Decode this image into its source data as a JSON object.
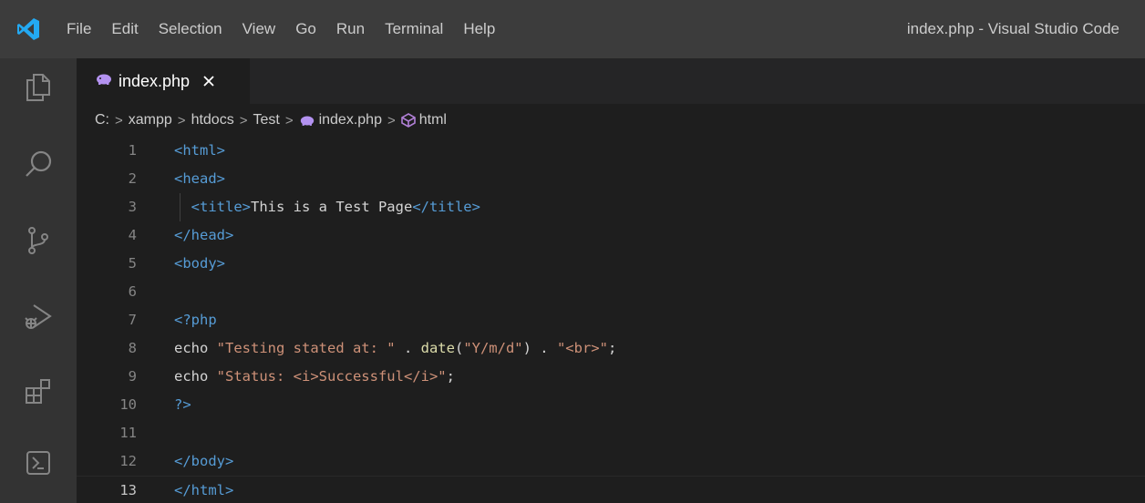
{
  "menu": {
    "items": [
      "File",
      "Edit",
      "Selection",
      "View",
      "Go",
      "Run",
      "Terminal",
      "Help"
    ]
  },
  "window_title": "index.php - Visual Studio Code",
  "tab": {
    "label": "index.php",
    "close": "✕"
  },
  "breadcrumb": {
    "items": [
      "C:",
      "xampp",
      "htdocs",
      "Test",
      "index.php",
      "html"
    ],
    "separator": ">"
  },
  "activity_icons": [
    "explorer-icon",
    "search-icon",
    "source-control-icon",
    "run-debug-icon",
    "extensions-icon",
    "terminal-icon"
  ],
  "editor": {
    "active_line": 13,
    "lines": [
      {
        "n": "1",
        "tokens": [
          [
            "tag",
            "<html>"
          ]
        ]
      },
      {
        "n": "2",
        "tokens": [
          [
            "tag",
            "<head>"
          ]
        ]
      },
      {
        "n": "3",
        "tokens": [
          [
            "tag",
            "  <title>"
          ],
          [
            "text",
            "This is a Test Page"
          ],
          [
            "tag",
            "</title>"
          ]
        ]
      },
      {
        "n": "4",
        "tokens": [
          [
            "tag",
            "</head>"
          ]
        ]
      },
      {
        "n": "5",
        "tokens": [
          [
            "tag",
            "<body>"
          ]
        ]
      },
      {
        "n": "6",
        "tokens": []
      },
      {
        "n": "7",
        "tokens": [
          [
            "php",
            "<?php"
          ]
        ]
      },
      {
        "n": "8",
        "tokens": [
          [
            "kw",
            "echo "
          ],
          [
            "str",
            "\"Testing stated at: \""
          ],
          [
            "kw",
            " . "
          ],
          [
            "fn",
            "date"
          ],
          [
            "kw",
            "("
          ],
          [
            "str",
            "\"Y/m/d\""
          ],
          [
            "kw",
            ") . "
          ],
          [
            "str",
            "\"<br>\""
          ],
          [
            "kw",
            ";"
          ]
        ]
      },
      {
        "n": "9",
        "tokens": [
          [
            "kw",
            "echo "
          ],
          [
            "str",
            "\"Status: <i>Successful</i>\""
          ],
          [
            "kw",
            ";"
          ]
        ]
      },
      {
        "n": "10",
        "tokens": [
          [
            "php",
            "?>"
          ]
        ]
      },
      {
        "n": "11",
        "tokens": []
      },
      {
        "n": "12",
        "tokens": [
          [
            "tag",
            "</body>"
          ]
        ]
      },
      {
        "n": "13",
        "tokens": [
          [
            "tag",
            "</html>"
          ]
        ]
      }
    ]
  },
  "colors": {
    "titlebar": "#3c3c3c",
    "activitybar": "#333333",
    "editor_bg": "#1e1e1e",
    "tag": "#569cd6",
    "string": "#ce9178",
    "function": "#dcdcaa",
    "php_icon": "#b392f0",
    "vscode_logo": "#23a9f2"
  }
}
